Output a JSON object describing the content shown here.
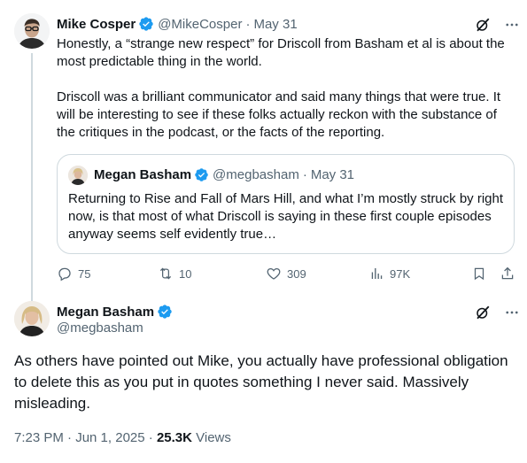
{
  "tweet1": {
    "author_name": "Mike Cosper",
    "handle": "@MikeCosper",
    "separator": "·",
    "date": "May 31",
    "paragraphs": [
      "Honestly, a “strange new respect” for Driscoll from Basham et al is about the most predictable thing in the world.",
      "Driscoll was a brilliant communicator and said many things that were true. It will be interesting to see if these folks actually reckon with the substance of the critiques in the podcast, or the facts of the reporting."
    ],
    "quote": {
      "author_name": "Megan Basham",
      "handle": "@megbasham",
      "separator": "·",
      "date": "May 31",
      "text": "Returning to Rise and Fall of Mars Hill, and what I’m mostly struck by right now, is that most of what Driscoll is saying in these first couple episodes anyway seems self evidently true…"
    },
    "metrics": {
      "replies": "75",
      "reposts": "10",
      "likes": "309",
      "views": "97K"
    }
  },
  "tweet2": {
    "author_name": "Megan Basham",
    "handle": "@megbasham",
    "text": "As others have pointed out Mike, you actually have professional obligation to delete this as you put in quotes something I never said. Massively misleading.",
    "timestamp": "7:23 PM · Jun 1, 2025",
    "separator": "·",
    "views_count": "25.3K",
    "views_label": "Views"
  },
  "colors": {
    "verified_blue": "#1d9bf0",
    "secondary_text": "#536471",
    "border": "#cfd9de"
  },
  "icons": [
    "grok-icon",
    "more-icon",
    "verified-icon",
    "reply-icon",
    "repost-icon",
    "like-icon",
    "views-icon",
    "bookmark-icon",
    "share-icon"
  ]
}
